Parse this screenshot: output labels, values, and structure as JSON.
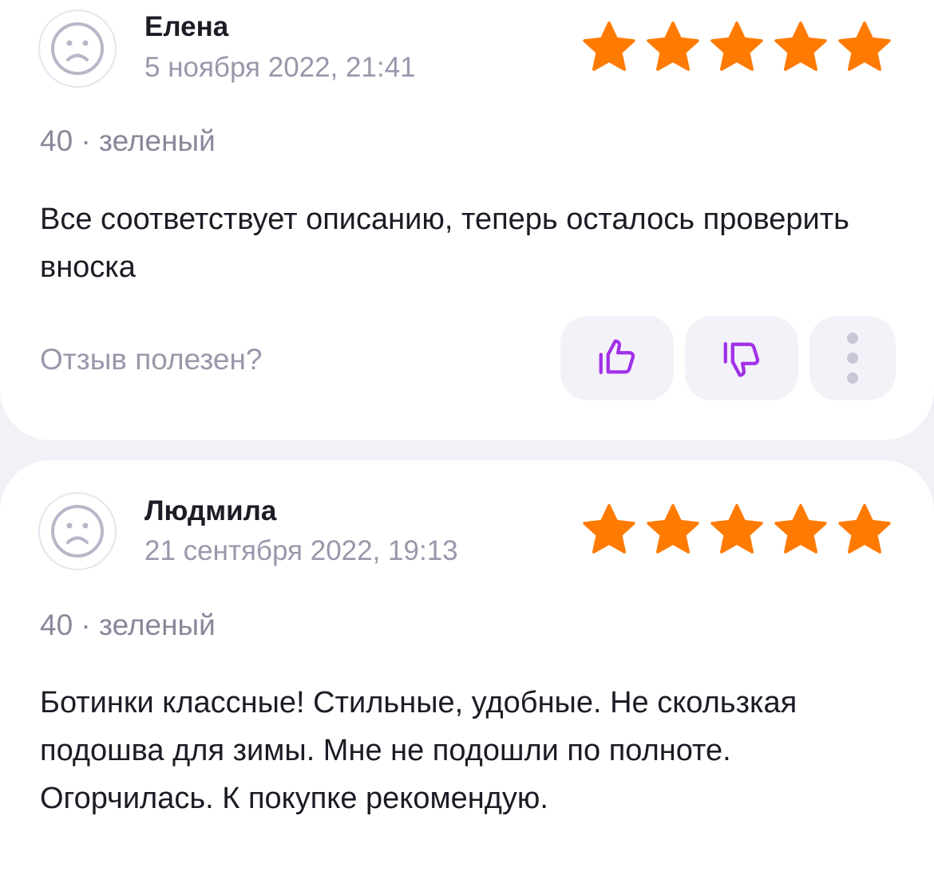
{
  "reviews": [
    {
      "author": "Елена",
      "date": "5 ноября 2022, 21:41",
      "rating": 5,
      "max_rating": 5,
      "variant": "40 · зеленый",
      "text": "Все соответствует описанию, теперь осталось проверить вноска",
      "helpful_label": "Отзыв полезен?"
    },
    {
      "author": "Людмила",
      "date": "21 сентября 2022, 19:13",
      "rating": 5,
      "max_rating": 5,
      "variant": "40 · зеленый",
      "text": "Ботинки классные! Стильные, удобные. Не скользкая подошва для зимы. Мне не подошли по полноте. Огорчилась. К покупке рекомендую."
    }
  ],
  "icons": {
    "avatar": "sad-face-icon",
    "star": "star-icon",
    "like": "thumbs-up-icon",
    "dislike": "thumbs-down-icon",
    "more": "more-vertical-icon"
  },
  "colors": {
    "star": "#ff7a00",
    "accent": "#a131e8",
    "background": "#f2f1f7",
    "card": "#ffffff",
    "muted_text": "#9a97ab",
    "text": "#1d1b24"
  }
}
